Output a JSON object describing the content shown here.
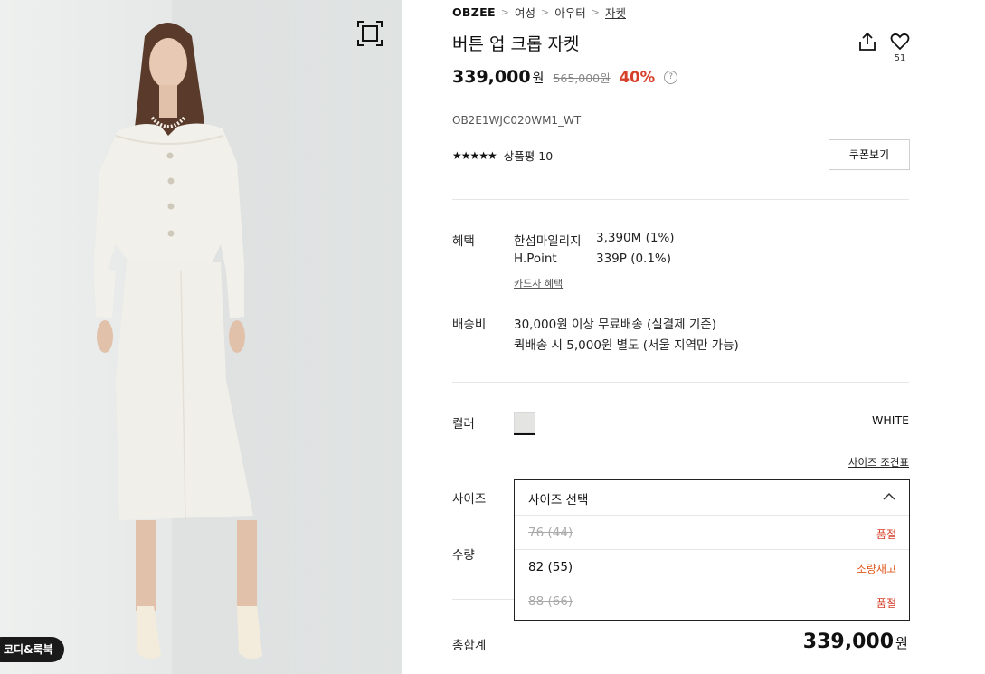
{
  "gallery": {
    "lookbook_label": "코디&룩북"
  },
  "breadcrumb": {
    "brand": "OBZEE",
    "items": [
      "여성",
      "아우터",
      "자켓"
    ]
  },
  "product": {
    "title": "버튼 업 크롭 자켓",
    "like_count": "51",
    "price": "339,000",
    "price_unit": "원",
    "original_price": "565,000원",
    "discount": "40%",
    "sku": "OB2E1WJC020WM1_WT",
    "rating_stars": "★★★★★",
    "review_label": "상품평 10",
    "coupon_label": "쿠폰보기"
  },
  "benefits": {
    "label": "혜택",
    "rows": [
      {
        "name": "한섬마일리지",
        "value": "3,390M (1%)"
      },
      {
        "name": "H.Point",
        "value": "339P (0.1%)"
      }
    ],
    "card_link": "카드사 혜택"
  },
  "shipping": {
    "label": "배송비",
    "lines": [
      "30,000원 이상 무료배송 (실결제 기준)",
      "퀵배송 시 5,000원 별도 (서울 지역만 가능)"
    ]
  },
  "color": {
    "label": "컬러",
    "selected": "WHITE",
    "swatch_color": "#e4e4e2"
  },
  "size": {
    "label": "사이즈",
    "chart_link": "사이즈 조견표",
    "placeholder": "사이즈 선택",
    "options": [
      {
        "name": "76 (44)",
        "status": "품절"
      },
      {
        "name": "82 (55)",
        "status": "소량재고"
      },
      {
        "name": "88 (66)",
        "status": "품절"
      }
    ]
  },
  "quantity": {
    "label": "수량"
  },
  "total": {
    "label": "총합계",
    "price": "339,000",
    "unit": "원"
  },
  "colors": {
    "accent_red": "#d6402b",
    "low_stock_orange": "#e05a1f"
  }
}
